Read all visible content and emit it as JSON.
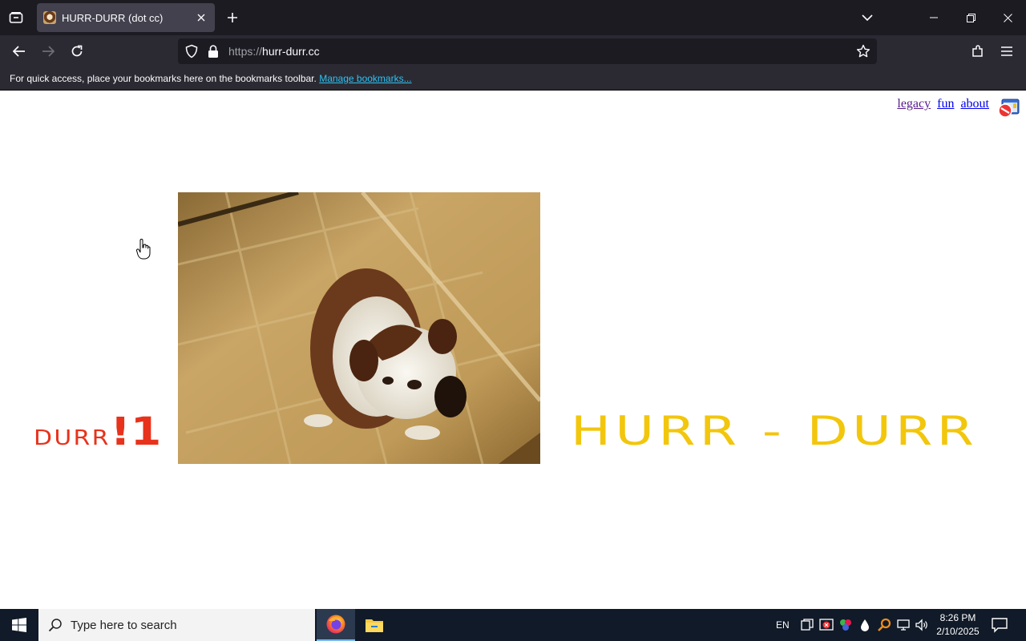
{
  "browser": {
    "tab_title": "HURR-DURR (dot cc)",
    "url_protocol": "https://",
    "url_host": "hurr-durr.cc",
    "bookmarks_message": "For quick access, place your bookmarks here on the bookmarks toolbar.",
    "manage_bookmarks_label": "Manage bookmarks...",
    "accent_color": "#2ac3f5"
  },
  "page": {
    "nav_links": [
      "legacy",
      "fun",
      "about"
    ],
    "durr_small": "DURR",
    "durr_big": "!1",
    "headline": "HURR - DURR",
    "durr_color": "#e8321b",
    "headline_color": "#f2c60c"
  },
  "taskbar": {
    "search_placeholder": "Type here to search",
    "language": "EN",
    "time": "8:26 PM",
    "date": "2/10/2025"
  }
}
